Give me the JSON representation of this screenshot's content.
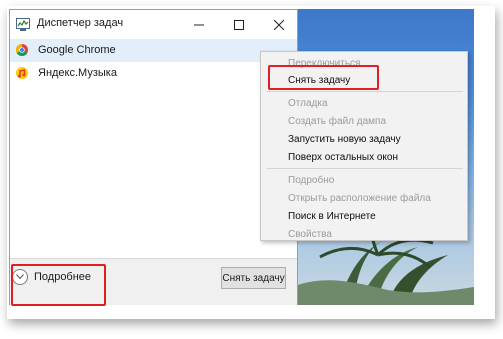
{
  "window": {
    "title": "Диспетчер задач"
  },
  "tasks": [
    {
      "name": "Google Chrome",
      "icon": "chrome-icon",
      "selected": true
    },
    {
      "name": "Яндекс.Музыка",
      "icon": "yandex-music-icon",
      "selected": false
    }
  ],
  "footer": {
    "more_label": "Подробнее",
    "end_task_label": "Снять задачу"
  },
  "context_menu": {
    "items": [
      {
        "label": "Переключиться",
        "enabled": false
      },
      {
        "label": "Снять задачу",
        "enabled": true
      },
      {
        "label": "Отладка",
        "enabled": false
      },
      {
        "label": "Создать файл дампа",
        "enabled": false
      },
      {
        "label": "Запустить новую задачу",
        "enabled": true
      },
      {
        "label": "Поверх остальных окон",
        "enabled": true
      },
      {
        "label": "Подробно",
        "enabled": false
      },
      {
        "label": "Открыть расположение файла",
        "enabled": false
      },
      {
        "label": "Поиск в Интернете",
        "enabled": true
      },
      {
        "label": "Свойства",
        "enabled": false
      }
    ]
  },
  "colors": {
    "highlight": "#e01e25",
    "selection": "#e2eef9",
    "disabled_text": "#9b9b9b"
  }
}
